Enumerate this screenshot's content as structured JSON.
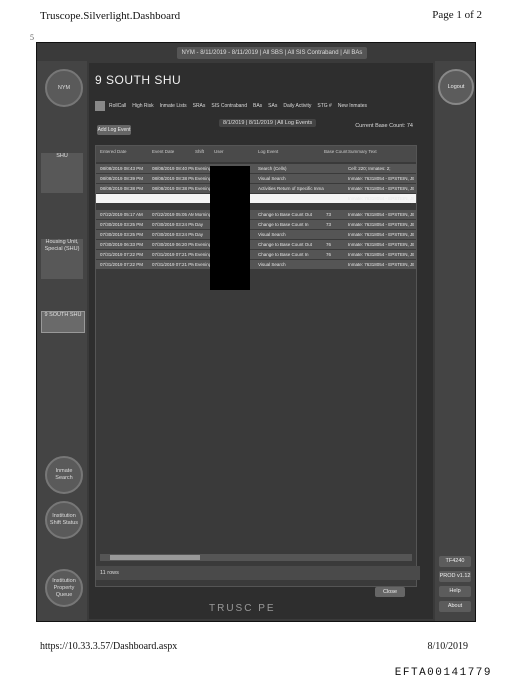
{
  "document": {
    "header_left": "Truscope.Silverlight.Dashboard",
    "header_right": "Page 1 of 2",
    "footer_url": "https://10.33.3.57/Dashboard.aspx",
    "footer_date": "8/10/2019",
    "bates": "EFTA00141779",
    "stray_mark": "5"
  },
  "app": {
    "topbar": "NYM - 8/11/2019 - 8/11/2019 | All SBS | All SIS Contraband | All BAs",
    "nav": {
      "logo": "NYM",
      "shu": "SHU",
      "housing": "Housing Unit, Special (SHU)",
      "nine_south": "9 SOUTH SHU",
      "inmate_search": "Inmate Search",
      "shift_status": "Institution Shift Status",
      "property_queue": "Institution Property Queue"
    },
    "right": {
      "logout": "Logout",
      "b1": "TF4240",
      "b2": "PROD v1.12",
      "help": "Help",
      "about": "About"
    },
    "title": "9 SOUTH SHU",
    "tabs": [
      "RollCall",
      "High Risk",
      "Inmate Lists",
      "SRAs",
      "SIS Contraband",
      "BAs",
      "SAs",
      "Daily Activity",
      "STG #",
      "New Inmates"
    ],
    "date_range": "8/1/2019 | 8/11/2019 | All Log Events",
    "add_log": "Add Log Event",
    "census": "Current Base Count: 74",
    "grid": {
      "columns": [
        "Entered Date",
        "Event Date",
        "Shift",
        "User",
        "Log Event",
        "Base Count",
        "Summary Text"
      ],
      "rows": [
        [
          "08/08/2019 08:43 PM",
          "08/08/2019 08:40 PM",
          "Evening",
          "",
          "Search (Cells)",
          "",
          "Cell: 220; Inmates: 2;"
        ],
        [
          "08/08/2019 08:39 PM",
          "08/08/2019 08:38 PM",
          "Evening",
          "",
          "Visual Search",
          "",
          "Inmate: 76318054 - EPSTEIN, JEFFREY"
        ],
        [
          "08/08/2019 08:38 PM",
          "08/08/2019 08:38 PM",
          "Evening",
          "",
          "Activities Return of Specific Inmate(s)",
          "",
          "Inmate: 76318054 - EPSTEIN, JEFFREY"
        ],
        [
          "",
          "",
          "",
          "",
          "",
          "",
          "Inmate: 76318054 - EPSTEIN, JEFFREY"
        ],
        [
          "07/22/2019 05:17 AM",
          "07/22/2019 05:05 AM",
          "Morning",
          "",
          "Change to Base Count Out",
          "73",
          "Inmate: 76318054 - EPSTEIN, JEFFREY"
        ],
        [
          "07/30/2019 03:25 PM",
          "07/30/2019 03:24 PM",
          "Day",
          "",
          "Change to Base Count In",
          "73",
          "Inmate: 76318054 - EPSTEIN, JEFFREY"
        ],
        [
          "07/30/2019 03:25 PM",
          "07/30/2019 03:24 PM",
          "Day",
          "",
          "Visual Search",
          "",
          "Inmate: 76318054 - EPSTEIN, JEFFREY"
        ],
        [
          "07/30/2019 06:33 PM",
          "07/30/2019 06:20 PM",
          "Evening",
          "",
          "Change to Base Count Out",
          "76",
          "Inmate: 76318054 - EPSTEIN, JEFFREY"
        ],
        [
          "07/31/2019 07:22 PM",
          "07/31/2019 07:21 PM",
          "Evening",
          "",
          "Change to Base Count In",
          "76",
          "Inmate: 76318054 - EPSTEIN, JEFFREY"
        ],
        [
          "07/31/2019 07:22 PM",
          "07/31/2019 07:21 PM",
          "Evening",
          "",
          "Visual Search",
          "",
          "Inmate: 76318054 - EPSTEIN, JEFFREY"
        ]
      ],
      "footer": "11 rows"
    },
    "close": "Close",
    "brand": "TRUSC PE"
  }
}
